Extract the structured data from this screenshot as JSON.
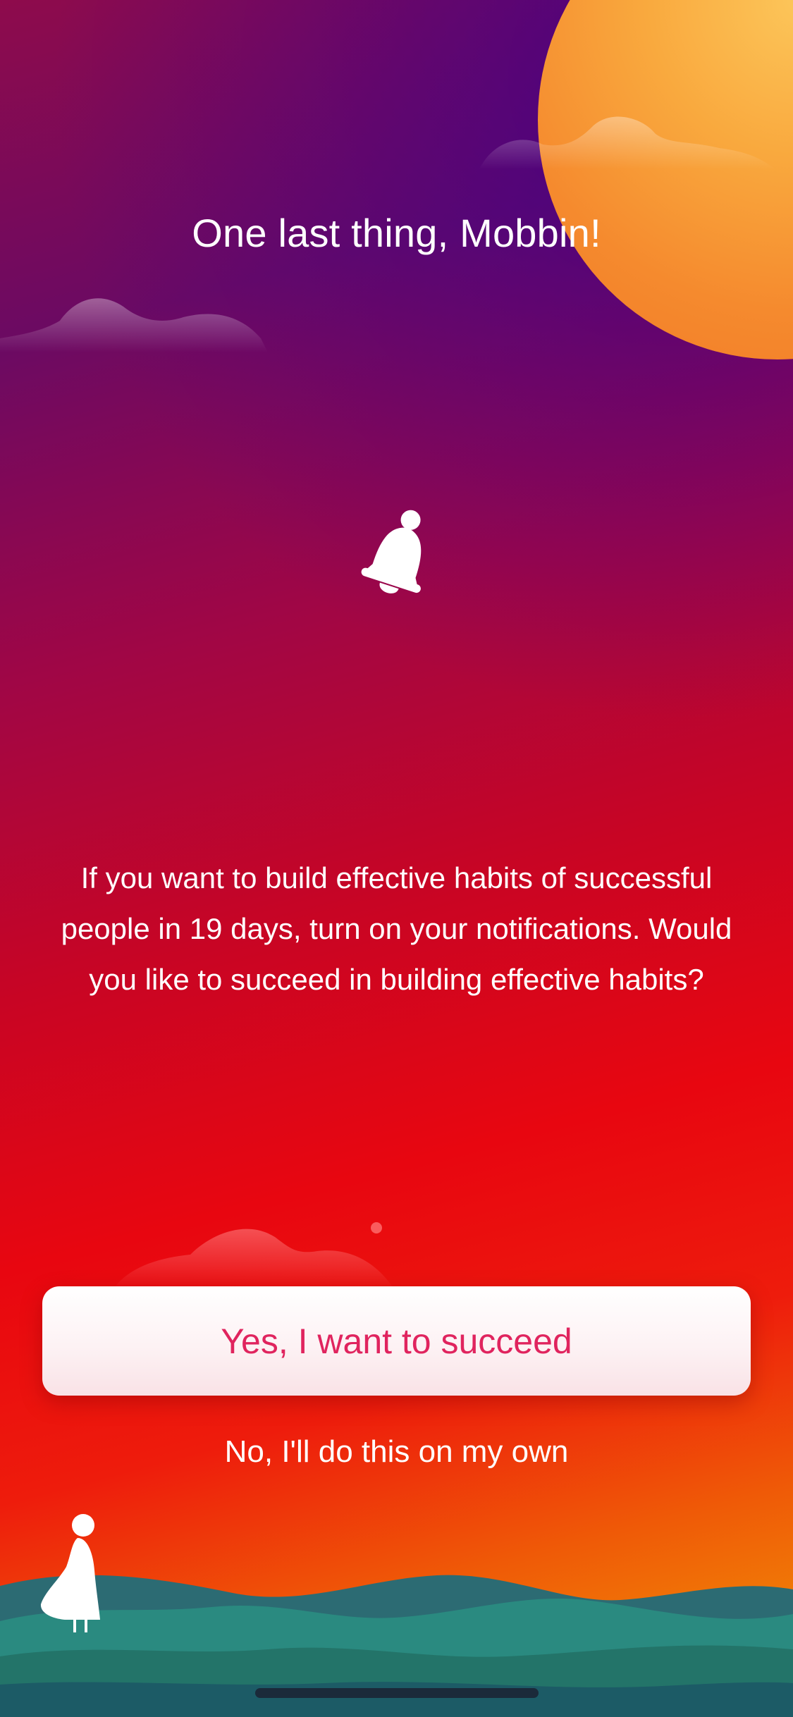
{
  "screen": {
    "title": "One last thing, Mobbin!",
    "icon": "bell-icon",
    "message": "If you want to build effective habits of successful people in 19 days, turn on your notifications. Would you like to succeed in building effective habits?",
    "primary_action": "Yes, I want to succeed",
    "secondary_action": "No, I'll do this on my own"
  },
  "colors": {
    "accent": "#e0245e",
    "text": "#ffffff",
    "sun": "#f9a93e",
    "hills": "#2a8a80"
  }
}
